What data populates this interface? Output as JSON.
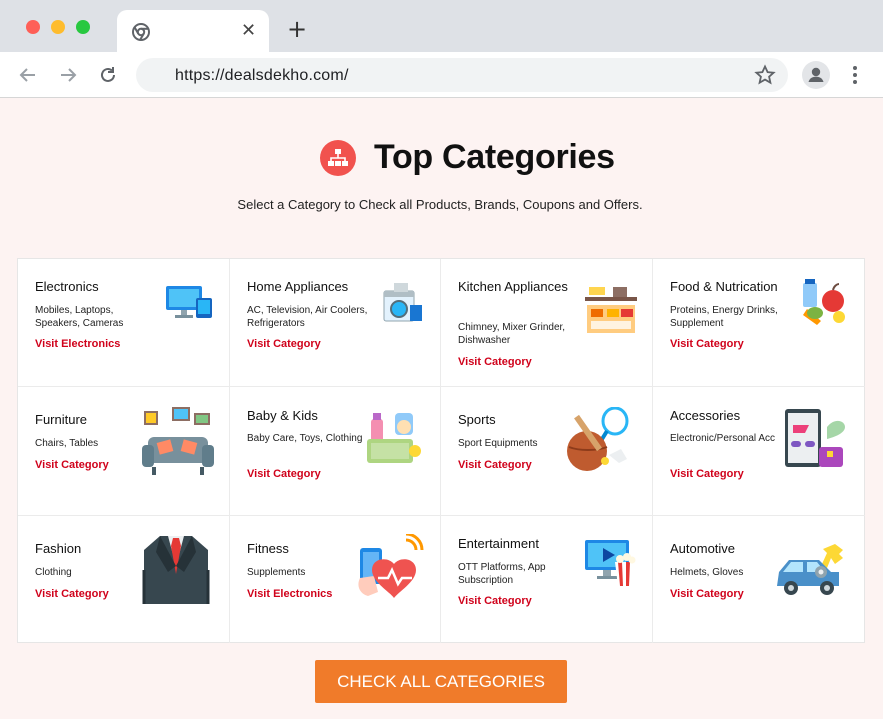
{
  "browser": {
    "url": "https://dealsdekho.com/",
    "close_glyph": "✕",
    "newtab_glyph": "+"
  },
  "page": {
    "title": "Top Categories",
    "subtitle": "Select a Category to Check all Products, Brands, Coupons and Offers.",
    "cta_label": "CHECK ALL CATEGORIES"
  },
  "categories": [
    {
      "name": "Electronics",
      "desc": "Mobiles, Laptops, Speakers, Cameras",
      "link": "Visit Electronics",
      "icon": "computer-devices-icon"
    },
    {
      "name": "Home Appliances",
      "desc": "AC, Television, Air Coolers, Refrigerators",
      "link": "Visit Category",
      "icon": "washing-machine-icon"
    },
    {
      "name": "Kitchen Appliances",
      "desc": "Chimney, Mixer Grinder, Dishwasher",
      "link": "Visit Category",
      "icon": "kitchen-icon"
    },
    {
      "name": "Food & Nutrication",
      "desc": "Proteins, Energy Drinks, Supplement",
      "link": "Visit Category",
      "icon": "fruits-icon"
    },
    {
      "name": "Furniture",
      "desc": "Chairs, Tables",
      "link": "Visit Category",
      "icon": "sofa-icon"
    },
    {
      "name": "Baby & Kids",
      "desc": "Baby Care, Toys, Clothing",
      "link": "Visit Category",
      "icon": "baby-products-icon"
    },
    {
      "name": "Sports",
      "desc": "Sport Equipments",
      "link": "Visit Category",
      "icon": "sports-equipment-icon"
    },
    {
      "name": "Accessories",
      "desc": "Electronic/Personal Acc",
      "link": "Visit Category",
      "icon": "accessories-icon"
    },
    {
      "name": "Fashion",
      "desc": "Clothing",
      "link": "Visit Category",
      "icon": "suit-icon"
    },
    {
      "name": "Fitness",
      "desc": "Supplements",
      "link": "Visit Electronics",
      "icon": "fitness-tracker-icon"
    },
    {
      "name": "Entertainment",
      "desc": "OTT Platforms, App Subscription",
      "link": "Visit Category",
      "icon": "monitor-popcorn-icon"
    },
    {
      "name": "Automotive",
      "desc": "Helmets, Gloves",
      "link": "Visit Category",
      "icon": "car-wrench-icon"
    }
  ],
  "colors": {
    "accent_red": "#d0021b",
    "cta_orange": "#f07b2a",
    "icon_red": "#f1524e",
    "page_bg": "#fdf3f2"
  }
}
